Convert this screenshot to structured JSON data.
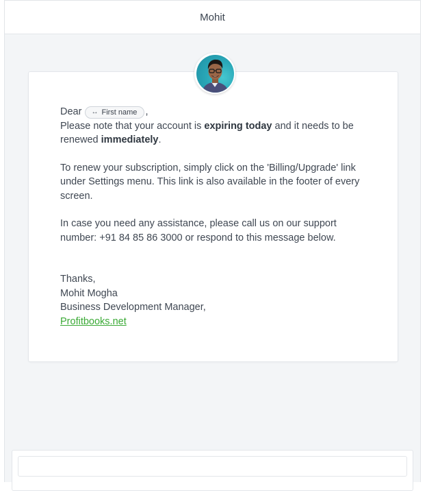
{
  "header": {
    "title": "Mohit"
  },
  "avatar": {
    "alt_icon": "person-photo-icon"
  },
  "message": {
    "greeting": "Dear",
    "merge_tag": {
      "icon": "↔",
      "label": "First name"
    },
    "greeting_comma": ",",
    "line1_pre": "Please note that your account is ",
    "line1_bold": "expiring today",
    "line1_mid": " and it needs to be renewed ",
    "line1_bold2": "immediately",
    "line1_end": ".",
    "para2": "To renew your subscription, simply click on the 'Billing/Upgrade' link under Settings menu. This link is also available in the footer of every screen.",
    "para3": "In case you need any assistance, please call us on our support number: +91 84 85 86 3000 or respond to this message below.",
    "sign_thanks": "Thanks,",
    "sign_name": "Mohit Mogha",
    "sign_title": "Business Development Manager,",
    "sign_link": "Profitbooks.net"
  },
  "reply": {
    "placeholder": ""
  },
  "colors": {
    "link": "#3aa935",
    "background": "#f3f5f7",
    "avatar_bg": "#2aa8b8"
  }
}
